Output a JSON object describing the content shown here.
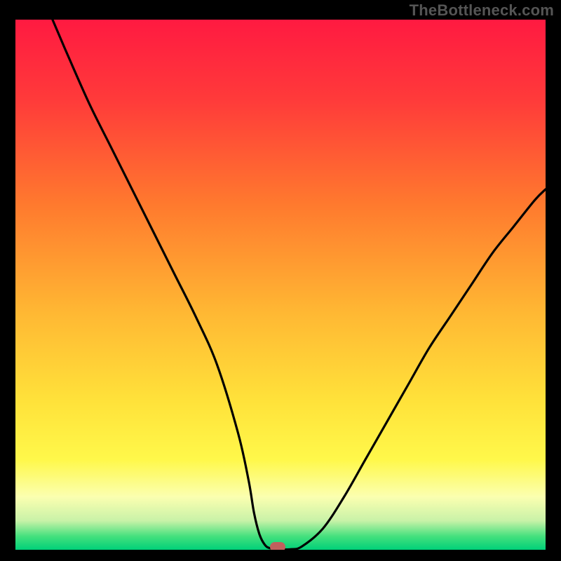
{
  "watermark": "TheBottleneck.com",
  "colors": {
    "frame": "#000000",
    "marker": "#c1605d",
    "watermark_text": "#555555",
    "gradient_stops": [
      {
        "offset": 0.0,
        "color": "#ff1a41"
      },
      {
        "offset": 0.15,
        "color": "#ff3a3a"
      },
      {
        "offset": 0.35,
        "color": "#ff7a2e"
      },
      {
        "offset": 0.55,
        "color": "#ffb733"
      },
      {
        "offset": 0.72,
        "color": "#ffe23a"
      },
      {
        "offset": 0.83,
        "color": "#fff84a"
      },
      {
        "offset": 0.9,
        "color": "#fbffb0"
      },
      {
        "offset": 0.945,
        "color": "#c9f2a8"
      },
      {
        "offset": 0.975,
        "color": "#43e07d"
      },
      {
        "offset": 1.0,
        "color": "#00d079"
      }
    ],
    "curve": "#000000"
  },
  "chart_data": {
    "type": "line",
    "title": "",
    "xlabel": "",
    "ylabel": "",
    "xlim": [
      0,
      100
    ],
    "ylim": [
      0,
      100
    ],
    "grid": false,
    "legend": false,
    "series": [
      {
        "name": "bottleneck-curve",
        "x": [
          7,
          10,
          14,
          18,
          22,
          26,
          30,
          34,
          38,
          42,
          44,
          45,
          46,
          47,
          48,
          50,
          52,
          54,
          58,
          62,
          66,
          70,
          74,
          78,
          82,
          86,
          90,
          94,
          98,
          100
        ],
        "y": [
          100,
          93,
          84,
          76,
          68,
          60,
          52,
          44,
          35,
          22,
          13,
          7,
          3,
          1,
          0.3,
          0.1,
          0.1,
          0.6,
          4,
          10,
          17,
          24,
          31,
          38,
          44,
          50,
          56,
          61,
          66,
          68
        ]
      }
    ],
    "marker": {
      "x": 49.5,
      "y": 0.5
    },
    "flat_bottom": {
      "x_start": 45,
      "x_end": 52,
      "y": 0.2
    }
  }
}
